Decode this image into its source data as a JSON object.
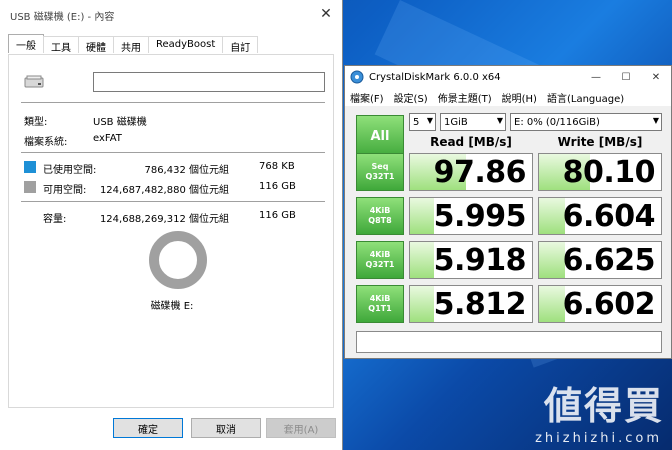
{
  "properties": {
    "title": "USB 磁碟機 (E:) - 內容",
    "tabs": [
      "一般",
      "工具",
      "硬體",
      "共用",
      "ReadyBoost",
      "自訂"
    ],
    "name_value": "",
    "type_label": "類型:",
    "type_value": "USB 磁碟機",
    "fs_label": "檔案系統:",
    "fs_value": "exFAT",
    "used_label": "已使用空間:",
    "used_bytes": "786,432 個位元組",
    "used_size": "768 KB",
    "free_label": "可用空間:",
    "free_bytes": "124,687,482,880 個位元組",
    "free_size": "116 GB",
    "capacity_label": "容量:",
    "capacity_bytes": "124,688,269,312 個位元組",
    "capacity_size": "116 GB",
    "drive_caption": "磁碟機 E:",
    "ok": "確定",
    "cancel": "取消",
    "apply": "套用(A)",
    "used_color": "#1e90d6",
    "free_color": "#a0a0a0"
  },
  "cdm": {
    "title": "CrystalDiskMark 6.0.0 x64",
    "menu": [
      "檔案(F)",
      "設定(S)",
      "佈景主題(T)",
      "說明(H)",
      "語言(Language)"
    ],
    "all_label": "All",
    "count": "5",
    "size": "1GiB",
    "drive": "E: 0% (0/116GiB)",
    "read_header": "Read [MB/s]",
    "write_header": "Write [MB/s]",
    "rows": [
      {
        "l1": "Seq",
        "l2": "Q32T1",
        "read": "97.86",
        "write": "80.10",
        "read_fill": 0.46,
        "write_fill": 0.42
      },
      {
        "l1": "4KiB",
        "l2": "Q8T8",
        "read": "5.995",
        "write": "6.604",
        "read_fill": 0.2,
        "write_fill": 0.21
      },
      {
        "l1": "4KiB",
        "l2": "Q32T1",
        "read": "5.918",
        "write": "6.625",
        "read_fill": 0.2,
        "write_fill": 0.21
      },
      {
        "l1": "4KiB",
        "l2": "Q1T1",
        "read": "5.812",
        "write": "6.602",
        "read_fill": 0.2,
        "write_fill": 0.21
      }
    ],
    "comment": ""
  },
  "watermark": "値得買",
  "watermark_url": "zhizhizhi.com"
}
